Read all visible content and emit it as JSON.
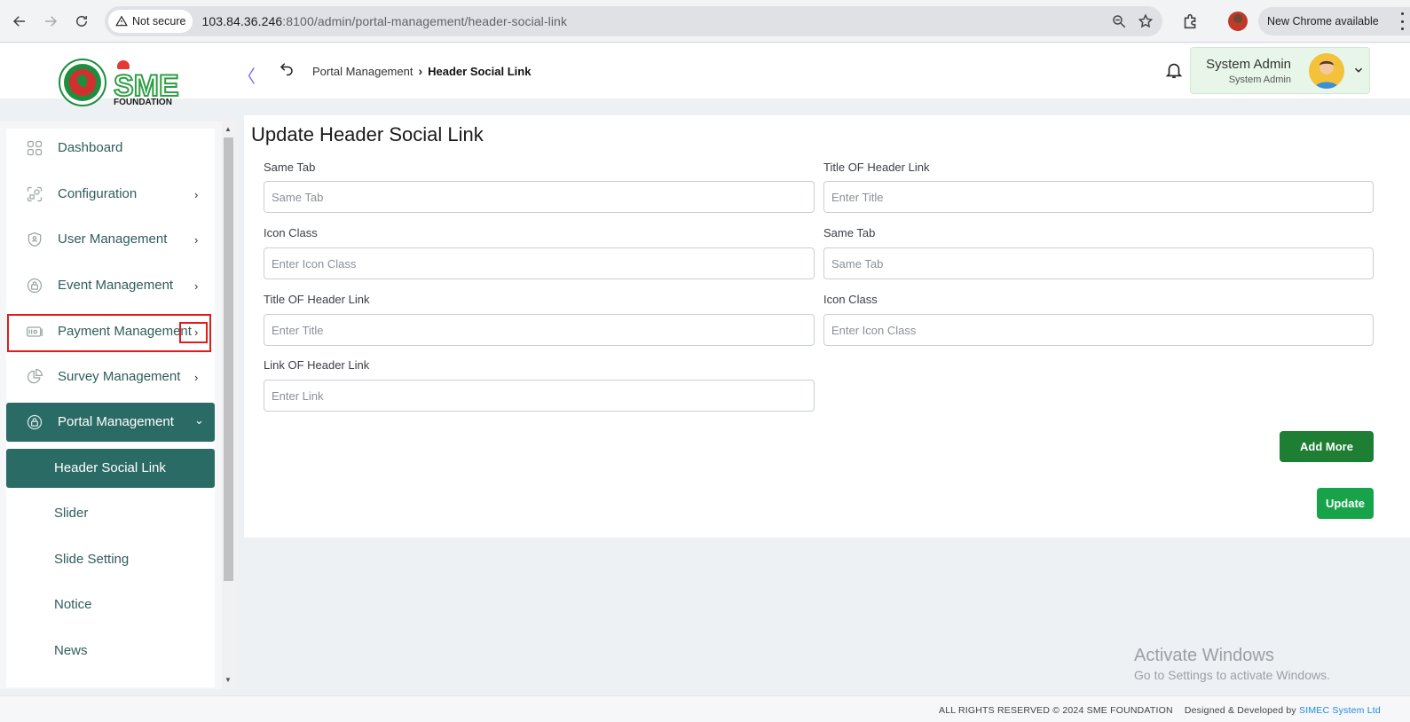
{
  "browser": {
    "security_label": "Not secure",
    "url_host": "103.84.36.246",
    "url_rest": ":8100/admin/portal-management/header-social-link",
    "update_label": "New Chrome available"
  },
  "header": {
    "breadcrumb_parent": "Portal Management",
    "breadcrumb_current": "Header Social Link",
    "user_name": "System Admin",
    "user_role": "System Admin"
  },
  "logo": {
    "brand": "SME",
    "sub": "FOUNDATION"
  },
  "sidebar": {
    "items": [
      {
        "label": "Dashboard",
        "icon": "grid-icon"
      },
      {
        "label": "Configuration",
        "icon": "config-icon"
      },
      {
        "label": "User Management",
        "icon": "shield-user-icon"
      },
      {
        "label": "Event Management",
        "icon": "lock-icon"
      },
      {
        "label": "Payment Management",
        "icon": "payment-icon"
      },
      {
        "label": "Survey Management",
        "icon": "pie-icon"
      },
      {
        "label": "Portal Management",
        "icon": "lock-icon"
      }
    ],
    "sub_items": [
      "Header Social Link",
      "Slider",
      "Slide Setting",
      "Notice",
      "News"
    ]
  },
  "form": {
    "title": "Update Header Social Link",
    "fields": [
      {
        "label": "Same Tab",
        "placeholder": "Same Tab"
      },
      {
        "label": "Title OF Header Link",
        "placeholder": "Enter Title"
      },
      {
        "label": "Icon Class",
        "placeholder": "Enter Icon Class"
      },
      {
        "label": "Same Tab",
        "placeholder": "Same Tab"
      },
      {
        "label": "Title OF Header Link",
        "placeholder": "Enter Title"
      },
      {
        "label": "Icon Class",
        "placeholder": "Enter Icon Class"
      },
      {
        "label": "Link OF Header Link",
        "placeholder": "Enter Link"
      }
    ],
    "add_more_label": "Add More",
    "update_label": "Update"
  },
  "watermark": {
    "line1": "Activate Windows",
    "line2": "Go to Settings to activate Windows."
  },
  "footer": {
    "rights": "ALL RIGHTS RESERVED © 2024 SME FOUNDATION",
    "designed_by": "Designed & Developed by",
    "company": "SIMEC System Ltd"
  },
  "colors": {
    "accent": "#2b6b66",
    "add_button": "#1e7e34",
    "update_button": "#16a34a",
    "highlight": "#e31b1b"
  }
}
